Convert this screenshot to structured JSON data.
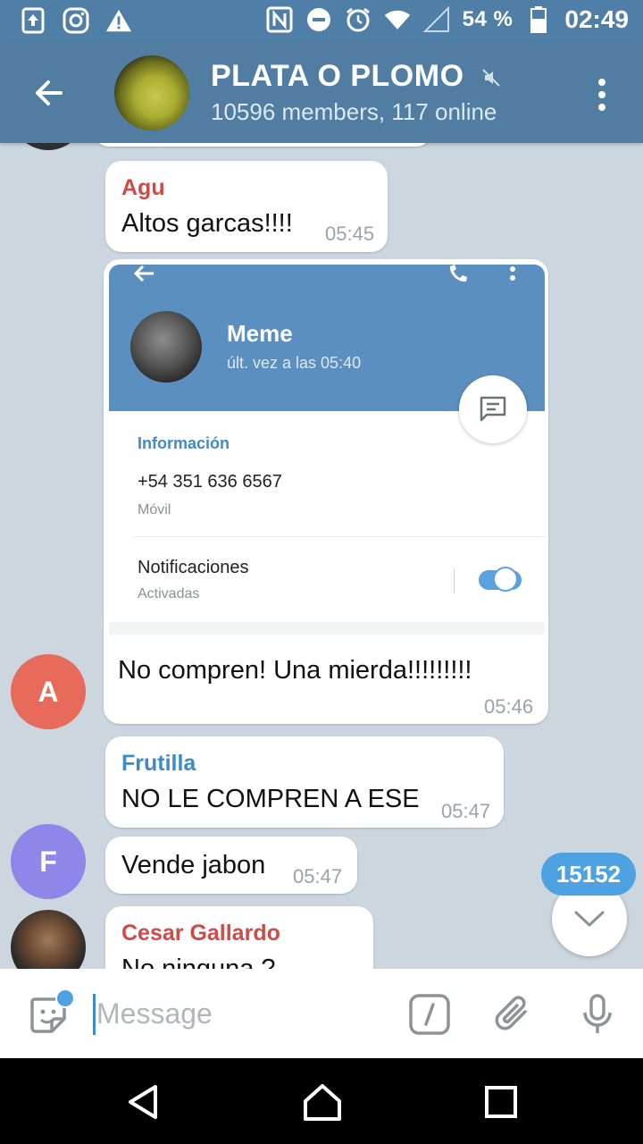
{
  "status_bar": {
    "battery_percent": "54 %",
    "time": "02:49",
    "icons": [
      "upload-icon",
      "instagram-icon",
      "warning-icon",
      "nfc-icon",
      "do-not-disturb-icon",
      "alarm-icon",
      "wifi-icon",
      "signal-icon",
      "battery-icon"
    ]
  },
  "header": {
    "title": "PLATA O PLOMO",
    "subtitle": "10596 members, 117 online"
  },
  "messages": [
    {
      "sender": "Agu",
      "text": "Altos garcas!!!!",
      "time": "05:45"
    },
    {
      "screenshot": {
        "contact_name": "Meme",
        "last_seen": "últ. vez a las 05:40",
        "info_label": "Información",
        "phone": "+54 351 636 6567",
        "phone_type": "Móvil",
        "notifications_label": "Notificaciones",
        "notifications_state": "Activadas"
      },
      "avatar_letter": "A",
      "text": "No compren! Una mierda!!!!!!!!!",
      "time": "05:46"
    },
    {
      "sender": "Frutilla",
      "text": "NO LE COMPREN A ESE",
      "time": "05:47"
    },
    {
      "avatar_letter": "F",
      "text": "Vende jabon",
      "time": "05:47"
    },
    {
      "sender": "Cesar Gallardo",
      "text": "No ninguna ?"
    }
  ],
  "unread_count": "15152",
  "input": {
    "placeholder": "Message"
  },
  "colors": {
    "header": "#517da2",
    "agu": "#cf4b47",
    "frutilla": "#3f8ac9",
    "cesar": "#cf4b47",
    "avatar_a": "#e86a5a",
    "avatar_f": "#8f86ea",
    "accent": "#4fa2e1"
  }
}
